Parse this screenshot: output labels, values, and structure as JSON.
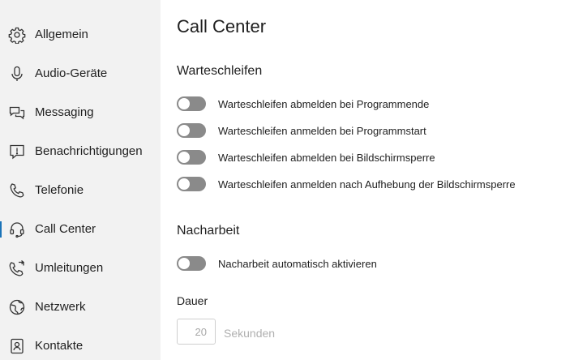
{
  "sidebar": {
    "items": [
      {
        "label": "Allgemein",
        "icon": "gear-icon"
      },
      {
        "label": "Audio-Geräte",
        "icon": "microphone-icon"
      },
      {
        "label": "Messaging",
        "icon": "chat-bubbles-icon"
      },
      {
        "label": "Benachrichtigungen",
        "icon": "notification-icon"
      },
      {
        "label": "Telefonie",
        "icon": "phone-icon"
      },
      {
        "label": "Call Center",
        "icon": "headset-icon",
        "active": true
      },
      {
        "label": "Umleitungen",
        "icon": "call-forward-icon"
      },
      {
        "label": "Netzwerk",
        "icon": "globe-icon"
      },
      {
        "label": "Kontakte",
        "icon": "contacts-icon"
      }
    ]
  },
  "main": {
    "title": "Call Center",
    "queues": {
      "title": "Warteschleifen",
      "toggles": [
        {
          "label": "Warteschleifen abmelden bei Programmende",
          "on": false
        },
        {
          "label": "Warteschleifen anmelden bei Programmstart",
          "on": false
        },
        {
          "label": "Warteschleifen abmelden bei Bildschirmsperre",
          "on": false
        },
        {
          "label": "Warteschleifen anmelden nach Aufhebung der Bildschirmsperre",
          "on": false
        }
      ]
    },
    "wrapup": {
      "title": "Nacharbeit",
      "toggle": {
        "label": "Nacharbeit automatisch aktivieren",
        "on": false
      },
      "duration_label": "Dauer",
      "duration_value": "20",
      "duration_unit": "Sekunden"
    }
  },
  "colors": {
    "sidebar_bg": "#f2f2f2",
    "toggle_off": "#8a8a8a",
    "active_indicator": "#1a73b8"
  }
}
